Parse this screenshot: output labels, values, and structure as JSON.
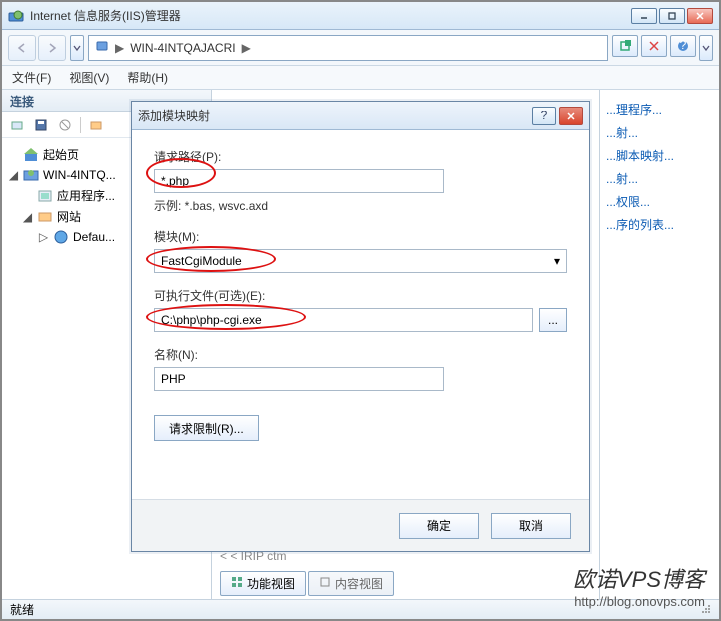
{
  "window": {
    "title": "Internet 信息服务(IIS)管理器"
  },
  "breadcrumb": {
    "server": "WIN-4INTQAJACRI",
    "arrow1": "▶",
    "arrow2": "▶"
  },
  "menu": {
    "file": "文件(F)",
    "view": "视图(V)",
    "help": "帮助(H)"
  },
  "left": {
    "header": "连接",
    "nodes": {
      "start": "起始页",
      "server": "WIN-4INTQ...",
      "apppools": "应用程序...",
      "sites": "网站",
      "default": "Defau..."
    }
  },
  "mid": {
    "crumbthin": "< < IRIP  ctm",
    "tab_feature": "功能视图",
    "tab_content": "内容视图"
  },
  "right": {
    "items": [
      "...理程序...",
      "...射...",
      "...脚本映射...",
      "...射...",
      "...权限...",
      "...序的列表..."
    ]
  },
  "modal": {
    "title": "添加模块映射",
    "labels": {
      "path": "请求路径(P):",
      "example": "示例: *.bas, wsvc.axd",
      "module": "模块(M):",
      "exe": "可执行文件(可选)(E):",
      "name": "名称(N):"
    },
    "values": {
      "path": "*.php",
      "module": "FastCgiModule",
      "exe": "C:\\php\\php-cgi.exe",
      "name": "PHP"
    },
    "buttons": {
      "limits": "请求限制(R)...",
      "ok": "确定",
      "cancel": "取消",
      "browse": "..."
    }
  },
  "watermark": {
    "line1": "欧诺VPS博客",
    "line2": "http://blog.onovps.com"
  },
  "status": {
    "ready": "就绪"
  }
}
